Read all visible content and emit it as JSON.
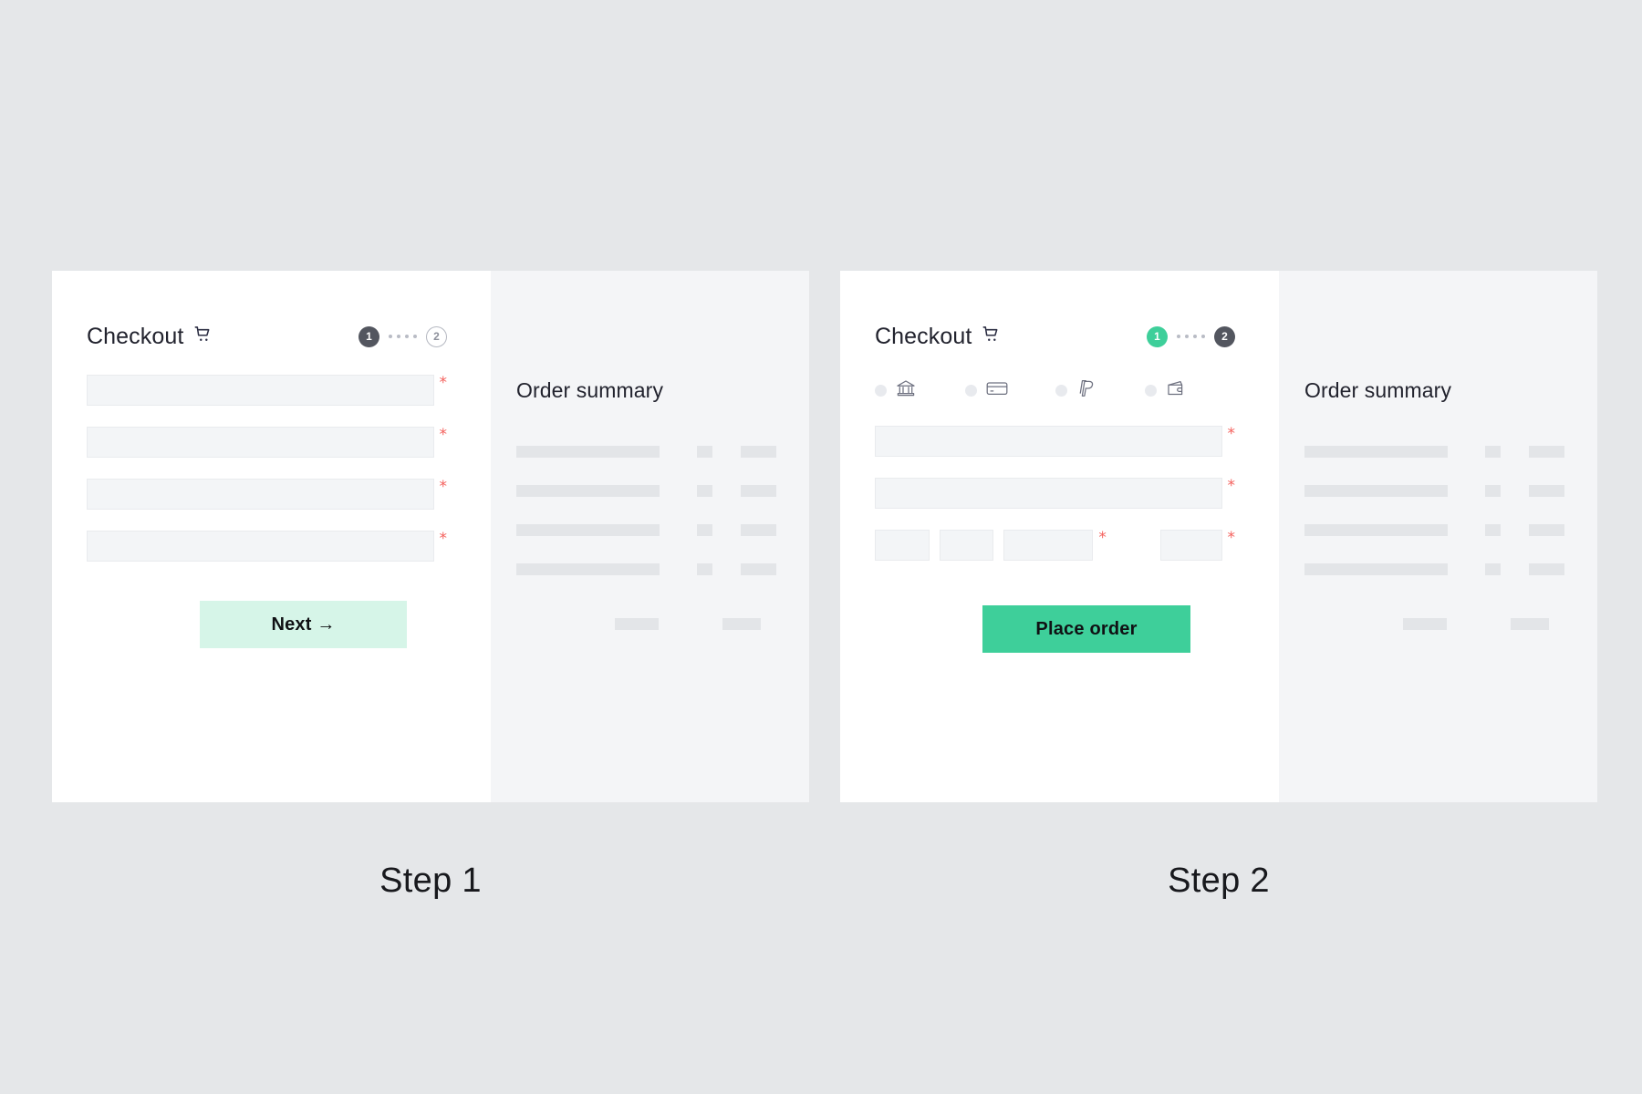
{
  "page": {
    "background_color": "#e5e7e9",
    "captions": [
      {
        "label": "Step 1"
      },
      {
        "label": "Step 2"
      }
    ]
  },
  "theme": {
    "accent_green": "#3ecf9a",
    "accent_green_soft": "#d6f5e8",
    "required_red": "#f4605c",
    "text_dark": "#22232e",
    "step_active_gray": "#53565f",
    "skeleton_gray": "#e3e5e8",
    "input_fill": "#f3f5f7",
    "summary_panel": "#f4f5f7"
  },
  "step1": {
    "header": {
      "title": "Checkout",
      "cart_icon": "shopping-cart-icon"
    },
    "stepper": {
      "steps": [
        {
          "number": "1",
          "state": "active"
        },
        {
          "number": "2",
          "state": "idle"
        }
      ],
      "connector_dots": 4
    },
    "form": {
      "fields": [
        {
          "name": "field-1",
          "value": "",
          "placeholder": "",
          "required_marker": "*"
        },
        {
          "name": "field-2",
          "value": "",
          "placeholder": "",
          "required_marker": "*"
        },
        {
          "name": "field-3",
          "value": "",
          "placeholder": "",
          "required_marker": "*"
        },
        {
          "name": "field-4",
          "value": "",
          "placeholder": "",
          "required_marker": "*"
        }
      ]
    },
    "primary_button": {
      "label": "Next →",
      "background": "#d6f5e8"
    },
    "summary": {
      "title": "Order summary",
      "line_items": [
        {
          "name_bar": true,
          "qty_bar": true,
          "price_bar": true
        },
        {
          "name_bar": true,
          "qty_bar": true,
          "price_bar": true
        },
        {
          "name_bar": true,
          "qty_bar": true,
          "price_bar": true
        },
        {
          "name_bar": true,
          "qty_bar": true,
          "price_bar": true
        }
      ],
      "total_row": {
        "label_bar": true,
        "value_bar": true
      }
    }
  },
  "step2": {
    "header": {
      "title": "Checkout",
      "cart_icon": "shopping-cart-icon"
    },
    "stepper": {
      "steps": [
        {
          "number": "1",
          "state": "done"
        },
        {
          "number": "2",
          "state": "active"
        }
      ],
      "connector_dots": 4
    },
    "payment_methods": [
      {
        "id": "bank-transfer",
        "icon": "bank-icon",
        "selected": false
      },
      {
        "id": "credit-card",
        "icon": "credit-card-icon",
        "selected": false
      },
      {
        "id": "paypal",
        "icon": "paypal-icon",
        "selected": false
      },
      {
        "id": "wallet",
        "icon": "wallet-icon",
        "selected": false
      }
    ],
    "form": {
      "fields": [
        {
          "name": "card-name",
          "value": "",
          "placeholder": "",
          "required_marker": "*"
        },
        {
          "name": "card-number",
          "value": "",
          "placeholder": "",
          "required_marker": "*"
        }
      ],
      "small_fields": [
        {
          "name": "expiry-month",
          "value": "",
          "placeholder": "",
          "required_marker": ""
        },
        {
          "name": "expiry-year",
          "value": "",
          "placeholder": "",
          "required_marker": ""
        },
        {
          "name": "expiry-full",
          "value": "",
          "placeholder": "",
          "required_marker": "*"
        },
        {
          "name": "cvv",
          "value": "",
          "placeholder": "",
          "required_marker": "*"
        }
      ]
    },
    "primary_button": {
      "label": "Place order",
      "background": "#3ecf9a"
    },
    "summary": {
      "title": "Order summary",
      "line_items": [
        {
          "name_bar": true,
          "qty_bar": true,
          "price_bar": true
        },
        {
          "name_bar": true,
          "qty_bar": true,
          "price_bar": true
        },
        {
          "name_bar": true,
          "qty_bar": true,
          "price_bar": true
        },
        {
          "name_bar": true,
          "qty_bar": true,
          "price_bar": true
        }
      ],
      "total_row": {
        "label_bar": true,
        "value_bar": true
      }
    }
  }
}
